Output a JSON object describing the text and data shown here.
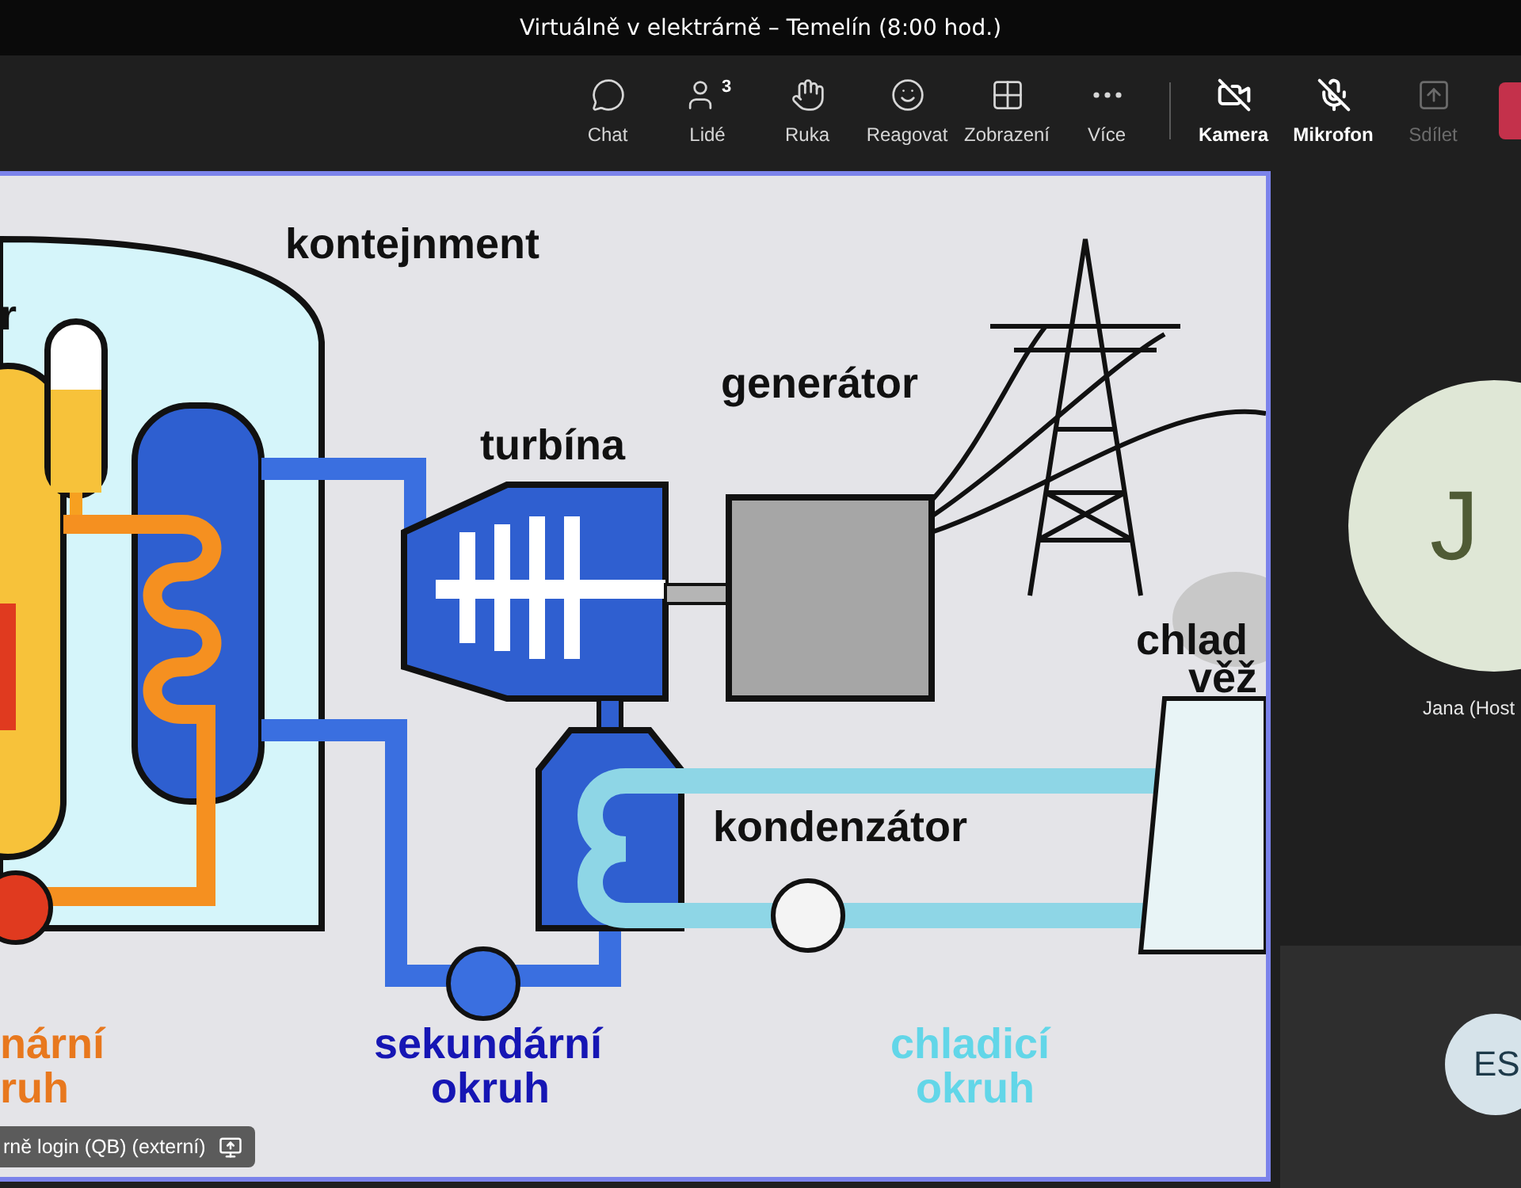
{
  "window": {
    "title": "Virtuálně v elektrárně – Temelín (8:00 hod.)"
  },
  "toolbar": [
    {
      "kind": "chat",
      "label": "Chat",
      "off": false,
      "disabled": false
    },
    {
      "kind": "people",
      "label": "Lidé",
      "badge": "3",
      "off": false,
      "disabled": false
    },
    {
      "kind": "hand",
      "label": "Ruka",
      "off": false,
      "disabled": false
    },
    {
      "kind": "react",
      "label": "Reagovat",
      "off": false,
      "disabled": false
    },
    {
      "kind": "view",
      "label": "Zobrazení",
      "off": false,
      "disabled": false
    },
    {
      "kind": "more",
      "label": "Více",
      "off": false,
      "disabled": false
    },
    {
      "kind": "camera",
      "label": "Kamera",
      "off": true,
      "disabled": false
    },
    {
      "kind": "mic",
      "label": "Mikrofon",
      "off": true,
      "disabled": false
    },
    {
      "kind": "share",
      "label": "Sdílet",
      "off": false,
      "disabled": true
    }
  ],
  "shared_screen": {
    "labels": [
      {
        "text": "r",
        "kind": "dark"
      },
      {
        "text": "kontejnment",
        "kind": "dark"
      },
      {
        "text": "generátor",
        "kind": "dark"
      },
      {
        "text": "turbína",
        "kind": "dark"
      },
      {
        "text": "chlad",
        "kind": "dark"
      },
      {
        "text": "věž",
        "kind": "dark"
      },
      {
        "text": "kondenzátor",
        "kind": "dark"
      },
      {
        "text": "nární",
        "kind": "primary"
      },
      {
        "text": "ruh",
        "kind": "primary"
      },
      {
        "text": "sekundární",
        "kind": "secondary"
      },
      {
        "text": "okruh",
        "kind": "secondary"
      },
      {
        "text": "chladicí",
        "kind": "cooling"
      },
      {
        "text": "okruh",
        "kind": "cooling"
      }
    ],
    "presenter": "rně login (QB) (externí)"
  },
  "participants": [
    {
      "initials": "J",
      "name": "Jana (Host"
    },
    {
      "initials": "ES"
    }
  ]
}
